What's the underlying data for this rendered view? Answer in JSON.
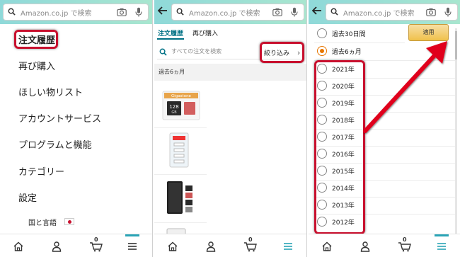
{
  "panels": {
    "p1": {
      "search_placeholder": "Amazon.co.jp で検索",
      "menu": [
        "注文履歴",
        "再び購入",
        "ほしい物リスト",
        "アカウントサービス",
        "プログラムと機能",
        "カテゴリー",
        "設定"
      ],
      "language_label": "国と言語",
      "highlighted_item": "注文履歴"
    },
    "p2": {
      "search_placeholder": "Amazon.co.jp で検索",
      "tabs": [
        "注文履歴",
        "再び購入"
      ],
      "orders_search_placeholder": "すべての注文を検索",
      "filter_label": "絞り込み",
      "filter_chevron": "›",
      "section_label": "過去6ヵ月",
      "product_texts": {
        "sd_brand": "Gigastone",
        "sd_capacity": "128",
        "sd_unit": "GB"
      }
    },
    "p3": {
      "search_placeholder": "Amazon.co.jp で検索",
      "apply_label": "適用",
      "options": [
        {
          "label": "過去30日間",
          "selected": false
        },
        {
          "label": "過去6ヵ月",
          "selected": true
        },
        {
          "label": "2021年",
          "selected": false
        },
        {
          "label": "2020年",
          "selected": false
        },
        {
          "label": "2019年",
          "selected": false
        },
        {
          "label": "2018年",
          "selected": false
        },
        {
          "label": "2017年",
          "selected": false
        },
        {
          "label": "2016年",
          "selected": false
        },
        {
          "label": "2015年",
          "selected": false
        },
        {
          "label": "2014年",
          "selected": false
        },
        {
          "label": "2013年",
          "selected": false
        },
        {
          "label": "2012年",
          "selected": false
        }
      ]
    }
  },
  "bottom_nav": {
    "icons": [
      "home-icon",
      "account-icon",
      "cart-icon",
      "menu-icon"
    ],
    "cart_count": "0"
  },
  "colors": {
    "topbar_start": "#8fd9d9",
    "topbar_end": "#a8e6cf",
    "accent_teal": "#007185",
    "highlight_red": "#c8102e",
    "radio_selected": "#e77600",
    "apply_button": "#f0c14b",
    "nav_active": "#2aa4b6"
  }
}
